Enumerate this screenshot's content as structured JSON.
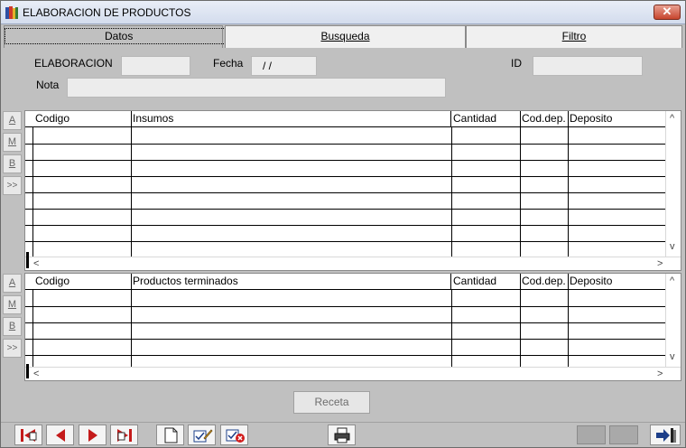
{
  "window": {
    "title": "ELABORACION DE PRODUCTOS",
    "close_label": "✕"
  },
  "tabs": [
    {
      "label": "Datos",
      "active": true
    },
    {
      "label": "Busqueda",
      "active": false
    },
    {
      "label": "Filtro",
      "active": false
    }
  ],
  "form": {
    "elaboracion_label": "ELABORACION",
    "elaboracion_value": "",
    "fecha_label": "Fecha",
    "fecha_value": " / /",
    "id_label": "ID",
    "id_value": "",
    "nota_label": "Nota",
    "nota_value": ""
  },
  "side_buttons": [
    "A",
    "M",
    "B",
    ">>"
  ],
  "insumos_grid": {
    "columns": [
      "Codigo",
      "Insumos",
      "Cantidad",
      "Cod.dep.",
      "Deposito"
    ],
    "rows": []
  },
  "productos_grid": {
    "columns": [
      "Codigo",
      "Productos terminados",
      "Cantidad",
      "Cod.dep.",
      "Deposito"
    ],
    "rows": []
  },
  "scroll_glyphs": {
    "up": "^",
    "down": "v",
    "left": "<",
    "right": ">"
  },
  "receta_label": "Receta",
  "toolbar": {
    "icons": [
      "first-record-icon",
      "prev-record-icon",
      "next-record-icon",
      "last-record-icon",
      "new-record-icon",
      "edit-record-icon",
      "delete-record-icon",
      "print-icon",
      "exit-icon"
    ]
  }
}
